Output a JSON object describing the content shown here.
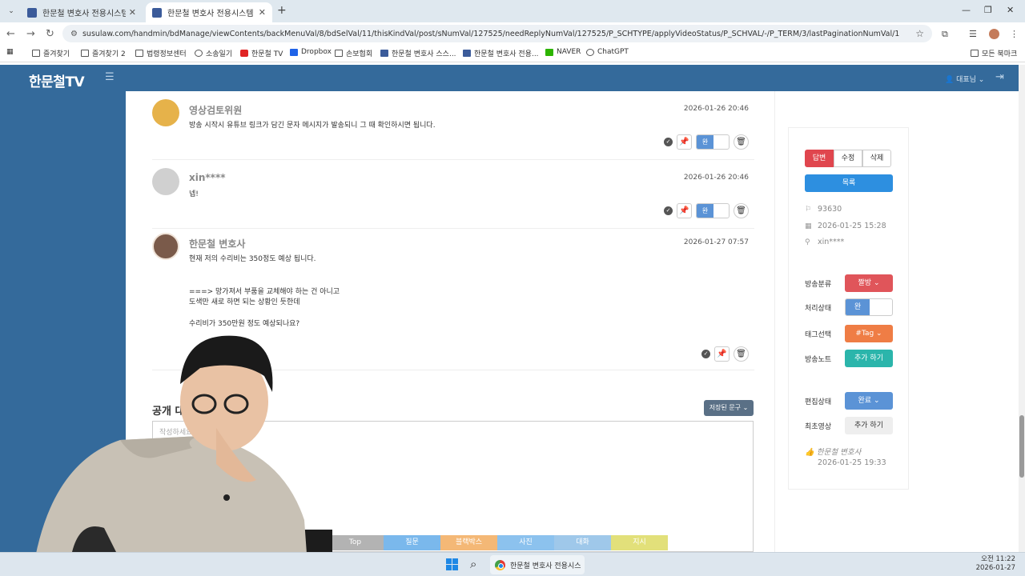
{
  "browser": {
    "tabs": [
      {
        "label": "한문철 변호사 전용시스템",
        "active": false
      },
      {
        "label": "한문철 변호사 전용시스템",
        "active": true
      }
    ],
    "url": "susulaw.com/handmin/bdManage/viewContents/backMenuVal/8/bdSelVal/11/thisKindVal/post/sNumVal/127525/needReplyNumVal/127525/P_SCHTYPE/applyVideoStatus/P_SCHVAL/-/P_TERM/3/lastPaginationNumVal/1",
    "bookmarks": [
      "즐겨찾기",
      "즐겨찾기 2",
      "법령정보센터",
      "소송일기",
      "한문철 TV",
      "Dropbox",
      "손보협회",
      "한문철 변호사 스스...",
      "한문철 변호사 전용...",
      "NAVER",
      "ChatGPT"
    ],
    "bookmarks_right": "모든 북마크"
  },
  "header": {
    "logo": "한문철TV",
    "user": "대표님"
  },
  "comments": [
    {
      "name": "영상검토위원",
      "date": "2026-01-26 20:46",
      "text": "방송 시작시 유튜브 링크가 담긴 문자 메시지가 발송되니 그 때 확인하시면 됩니다.",
      "toggle": "완"
    },
    {
      "name": "xin****",
      "date": "2026-01-26 20:46",
      "text": "넵!",
      "toggle": "완"
    },
    {
      "name": "한문철 변호사",
      "date": "2026-01-27 07:57",
      "text": "현재 저의 수리비는 350정도 예상 됩니다.\n\n\n===> 망가져서 부품을 교체해야 하는 건 아니고\n도색만 새로 하면 되는 상황인 듯한데\n\n수리비가 350만원 정도 예상되나요?"
    }
  ],
  "public_chat": {
    "title": "공개 대화",
    "saved_button": "저장된 문구",
    "placeholder": "작성하세요 ..."
  },
  "panel": {
    "buttons": {
      "reply": "답변",
      "edit": "수정",
      "delete": "삭제"
    },
    "list_button": "목록",
    "post_number": "93630",
    "post_date": "2026-01-25 15:28",
    "author": "xin****",
    "fields": [
      {
        "label": "방송분류",
        "value": "짤방"
      },
      {
        "label": "처리상태",
        "value": "완"
      },
      {
        "label": "태그선택",
        "value": "#Tag"
      },
      {
        "label": "방송노트",
        "value": "추가 하기"
      },
      {
        "label": "편집상태",
        "value": "완료"
      },
      {
        "label": "최초영상",
        "value": "추가 하기"
      }
    ],
    "edited_by": "한문철 변호사",
    "edited_date": "2026-01-25 19:33"
  },
  "quicknav": [
    "Top",
    "질문",
    "블랙박스",
    "사진",
    "대화",
    "지시"
  ],
  "quicknav_colors": [
    "#b3b3b3",
    "#7ab8ec",
    "#f4b876",
    "#8cc2ee",
    "#9fc8ea",
    "#e2e07a"
  ],
  "taskbar": {
    "app": "한문철 변호사 전용시스",
    "time": "오전 11:22",
    "date": "2026-01-27"
  }
}
